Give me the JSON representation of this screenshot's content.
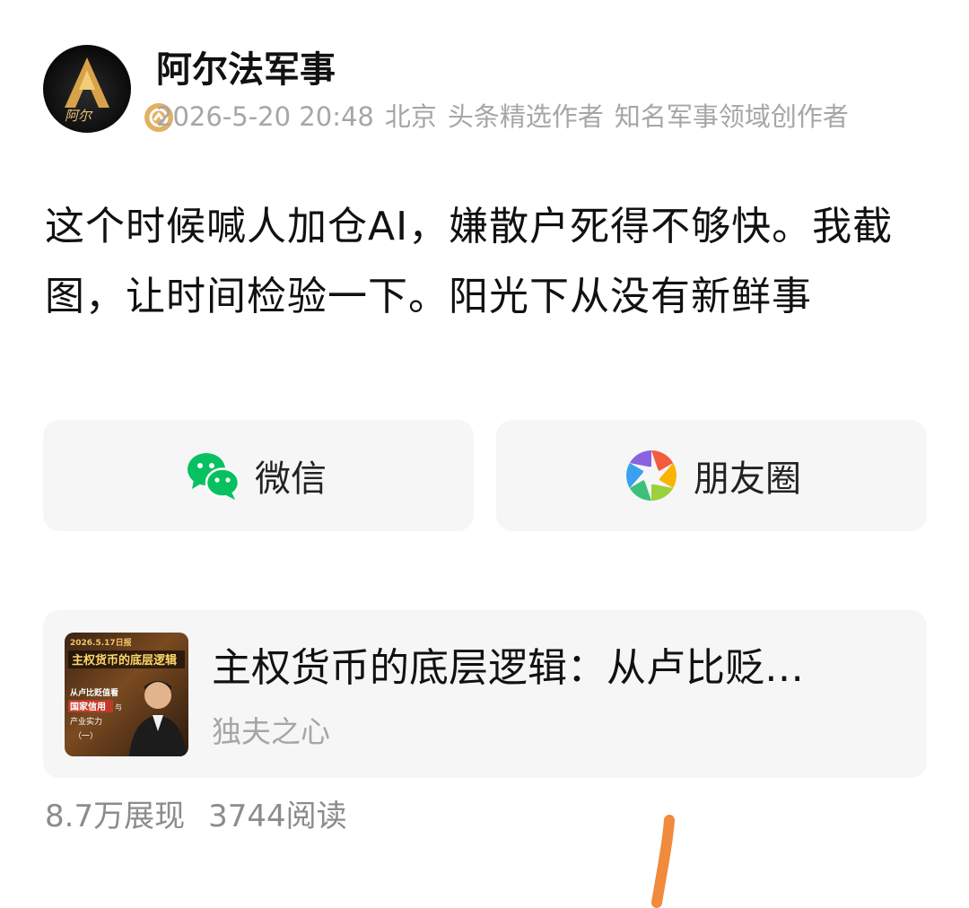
{
  "author": {
    "name": "阿尔法军事",
    "avatar_text": "阿尔",
    "date": "2026-5-20 20:48",
    "location": "北京",
    "tag1": "头条精选作者",
    "tag2": "知名军事领域创作者"
  },
  "post": {
    "text": "这个时候喊人加仓AI，嫌散户死得不够快。我截图，让时间检验一下。阳光下从没有新鲜事"
  },
  "share": {
    "wechat_label": "微信",
    "moments_label": "朋友圈"
  },
  "article": {
    "title": "主权货币的底层逻辑：从卢比贬…",
    "source": "独夫之心",
    "thumb": {
      "date_text": "2026.5.17日报",
      "headline": "主权货币的底层逻辑",
      "line1": "从卢比贬值看",
      "line2": "国家信用",
      "line3": "与",
      "line4": "产业实力",
      "line5": "（一）"
    }
  },
  "stats": {
    "impressions": "8.7万展现",
    "reads": "3744阅读"
  },
  "colors": {
    "wechat_green": "#07c160",
    "meta_gray": "#a6a6a6",
    "annotation_orange": "#f08a3c",
    "badge_gold": "#e3b063"
  }
}
